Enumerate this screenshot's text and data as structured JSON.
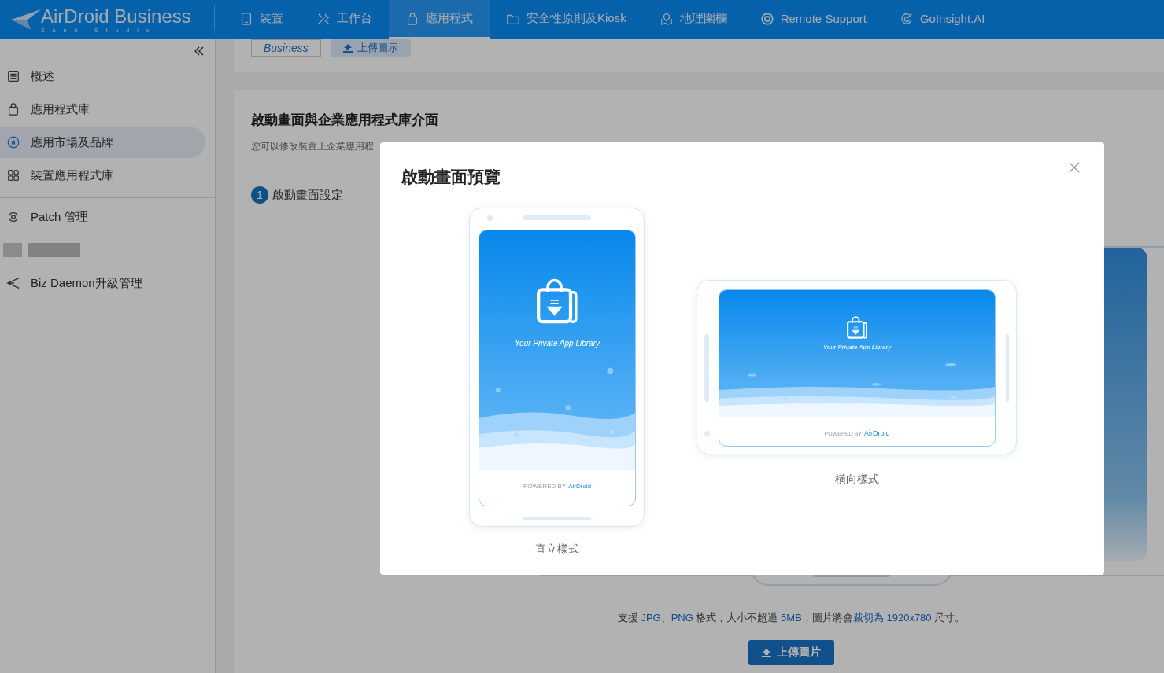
{
  "header": {
    "logo": {
      "name": "AirDroid Business",
      "tagline": "S a n d   S t u d i o"
    },
    "nav": [
      {
        "label": "裝置",
        "selected": false
      },
      {
        "label": "工作台",
        "selected": false
      },
      {
        "label": "應用程式",
        "selected": true
      },
      {
        "label": "安全性原則及Kiosk",
        "selected": false
      },
      {
        "label": "地理圍欄",
        "selected": false
      },
      {
        "label": "Remote Support",
        "selected": false
      },
      {
        "label": "GoInsight.AI",
        "selected": false
      }
    ]
  },
  "sidebar": {
    "groups": [
      [
        {
          "kind": "item",
          "label": "概述",
          "selected": false
        },
        {
          "kind": "item",
          "label": "應用程式庫",
          "selected": false
        },
        {
          "kind": "item",
          "label": "應用市場及品牌",
          "selected": true
        },
        {
          "kind": "item",
          "label": "裝置應用程式庫",
          "selected": false
        }
      ],
      [
        {
          "kind": "item",
          "label": "Patch 管理",
          "selected": false
        },
        {
          "kind": "redacted"
        },
        {
          "kind": "item",
          "label": "Biz Daemon升級管理",
          "selected": false
        }
      ]
    ]
  },
  "page": {
    "top_tag": "Business",
    "top_button": "上傳圖示",
    "section_title": "啟動畫面與企業應用程式庫介面",
    "description": "您可以修改裝置上企業應用程",
    "step": {
      "number": "1",
      "label": "啟動畫面設定"
    },
    "hint": [
      {
        "text": "支援 ",
        "highlight": false
      },
      {
        "text": "JPG、PNG",
        "highlight": true
      },
      {
        "text": " 格式，大小不超過 ",
        "highlight": false
      },
      {
        "text": "5MB",
        "highlight": true
      },
      {
        "text": "，圖片將會",
        "highlight": false
      },
      {
        "text": "裁切為 1920x780",
        "highlight": true
      },
      {
        "text": " 尺寸。",
        "highlight": false
      }
    ],
    "upload_button": "上傳圖片"
  },
  "modal": {
    "title": "啟動畫面預覽",
    "previews": [
      {
        "kind": "portrait",
        "caption": "直立樣式",
        "app_title": "Your Private App Library",
        "powered_by": "POWERED BY",
        "brand": "AirDroid"
      },
      {
        "kind": "landscape",
        "caption": "橫向樣式",
        "app_title": "Your Private App Library",
        "powered_by": "POWERED BY",
        "brand": "AirDroid"
      }
    ]
  }
}
